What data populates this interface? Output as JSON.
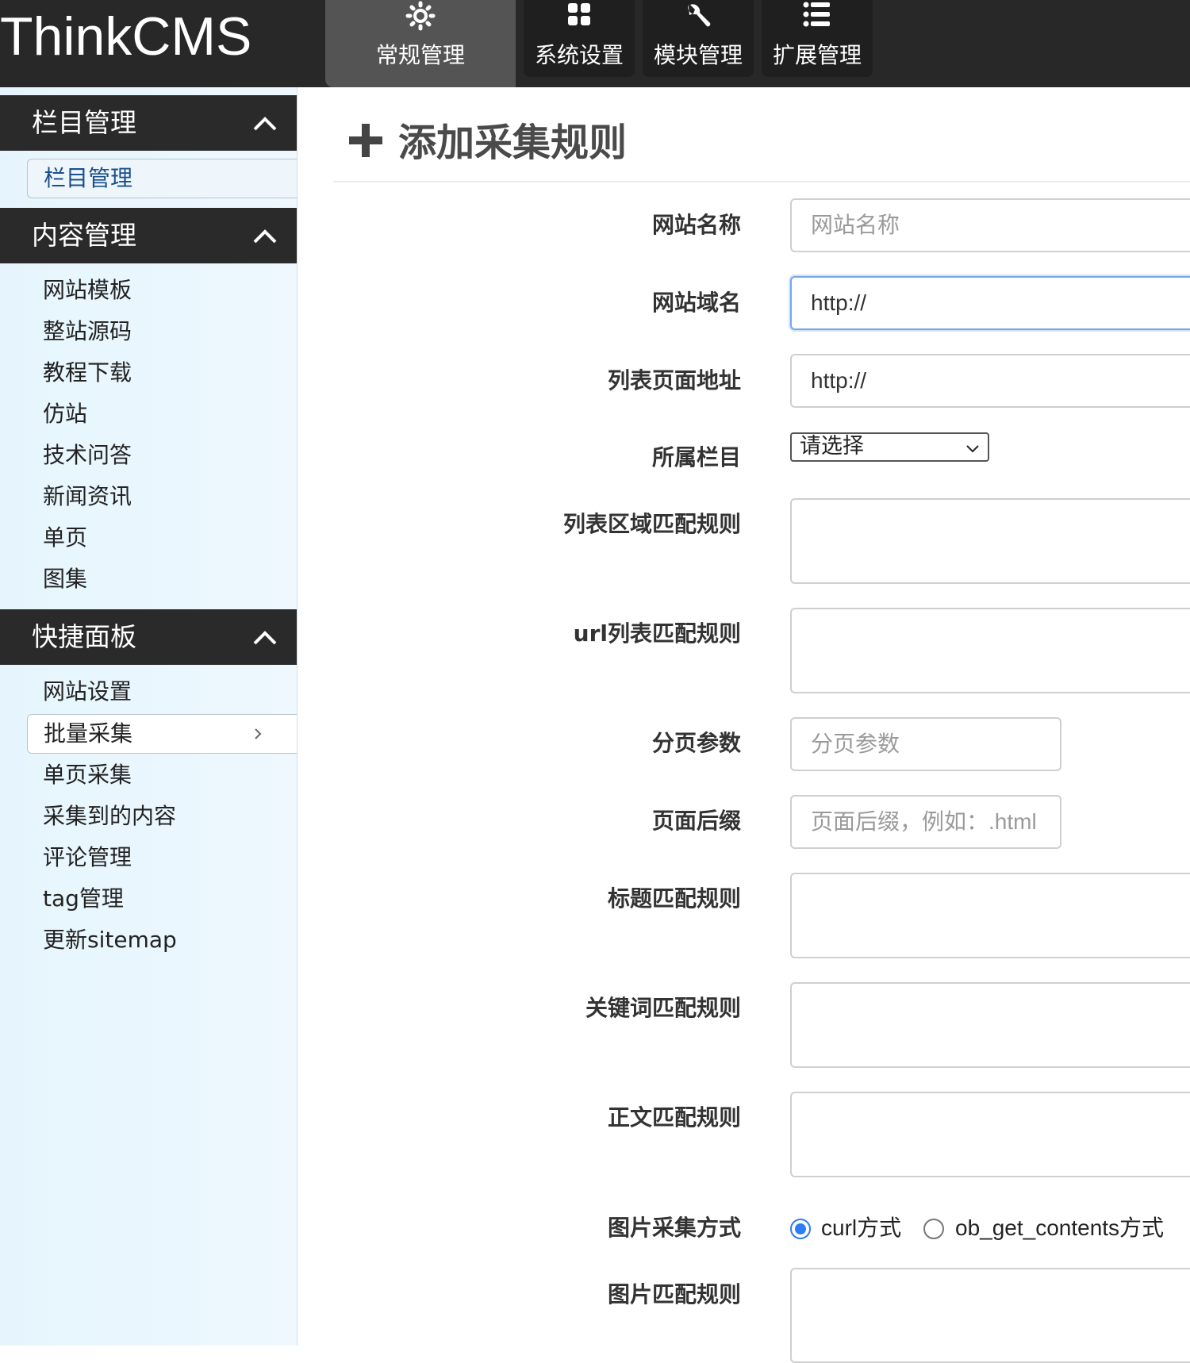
{
  "app": {
    "logo": "ThinkCMS"
  },
  "nav": {
    "tabs": [
      {
        "label": "常规管理",
        "icon": "settings-sun-icon",
        "active": true
      },
      {
        "label": "系统设置",
        "icon": "grid-icon",
        "active": false
      },
      {
        "label": "模块管理",
        "icon": "wrench-icon",
        "active": false
      },
      {
        "label": "扩展管理",
        "icon": "list-icon",
        "active": false
      }
    ]
  },
  "sidebar": {
    "sections": [
      {
        "title": "栏目管理",
        "items": [
          "栏目管理"
        ]
      },
      {
        "title": "内容管理",
        "items": [
          "网站模板",
          "整站源码",
          "教程下载",
          "仿站",
          "技术问答",
          "新闻资讯",
          "单页",
          "图集"
        ]
      },
      {
        "title": "快捷面板",
        "items": [
          "网站设置",
          "批量采集",
          "单页采集",
          "采集到的内容",
          "评论管理",
          "tag管理",
          "更新sitemap"
        ]
      }
    ],
    "active_item": "批量采集"
  },
  "page": {
    "title": "添加采集规则",
    "title_icon": "plus-icon"
  },
  "form": {
    "site_name": {
      "label": "网站名称",
      "placeholder": "网站名称"
    },
    "site_domain": {
      "label": "网站域名",
      "value": "http://"
    },
    "list_url": {
      "label": "列表页面地址",
      "value": "http://"
    },
    "category": {
      "label": "所属栏目",
      "selected": "请选择"
    },
    "list_area_rule": {
      "label": "列表区域匹配规则"
    },
    "url_list_rule": {
      "label": "url列表匹配规则"
    },
    "page_param": {
      "label": "分页参数",
      "placeholder": "分页参数"
    },
    "page_suffix": {
      "label": "页面后缀",
      "placeholder": "页面后缀，例如：.html"
    },
    "title_rule": {
      "label": "标题匹配规则"
    },
    "keyword_rule": {
      "label": "关键词匹配规则"
    },
    "content_rule": {
      "label": "正文匹配规则"
    },
    "image_method": {
      "label": "图片采集方式",
      "options": [
        "curl方式",
        "ob_get_contents方式"
      ],
      "selected": "curl方式"
    },
    "image_rule": {
      "label": "图片匹配规则"
    }
  },
  "colors": {
    "topbar": "#282828",
    "active_tab": "#545454",
    "sidebar_bg": "#e6f5fd",
    "radio_accent": "#2e7cf6",
    "focus_border": "#74a9e8"
  }
}
